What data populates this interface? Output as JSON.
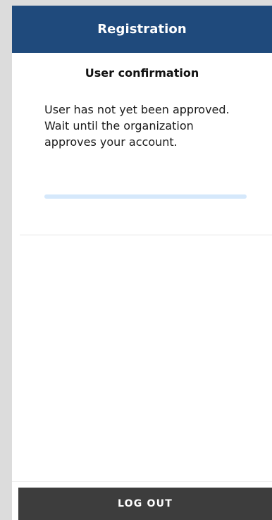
{
  "header": {
    "title": "Registration"
  },
  "confirmation": {
    "title": "User confirmation",
    "message": "User has not yet been approved. Wait until the organization approves your account.",
    "progress_percent": 100
  },
  "footer": {
    "logout_label": "LOG OUT"
  },
  "colors": {
    "header_bg": "#1f4a7c",
    "progress_bar": "#d5e8fb",
    "button_bg": "#3d3d3d"
  }
}
